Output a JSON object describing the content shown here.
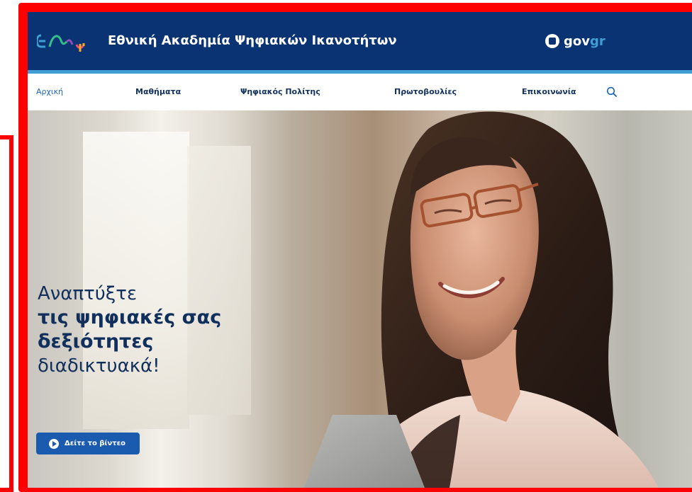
{
  "header": {
    "title": "Εθνική Ακαδημία Ψηφιακών Ικανοτήτων",
    "gov_brand": {
      "gov": "gov",
      "gr": "gr"
    }
  },
  "nav": {
    "items": [
      {
        "label": "Αρχική",
        "active": true
      },
      {
        "label": "Μαθήματα",
        "active": false
      },
      {
        "label": "Ψηφιακός Πολίτης",
        "active": false
      },
      {
        "label": "Πρωτοβουλίες",
        "active": false
      },
      {
        "label": "Επικοινωνία",
        "active": false
      }
    ],
    "search_icon": "search-icon"
  },
  "hero": {
    "line1": "Αναπτύξτε",
    "line2": "τις ψηφιακές σας",
    "line3": "δεξιότητες",
    "line4": "διαδικτυακά!",
    "button_label": "Δείτε το βίντεο",
    "button_icon": "play-icon"
  },
  "colors": {
    "header_bg": "#0a3373",
    "accent_stripe": "#3f9fd5",
    "nav_text": "#12325e",
    "button_bg": "#1a5bb0",
    "frame_red": "#ff0000"
  }
}
